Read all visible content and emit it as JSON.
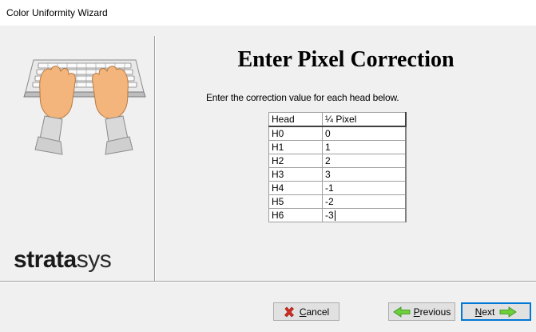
{
  "window": {
    "title": "Color Uniformity Wizard"
  },
  "brand": {
    "logo_bold": "strata",
    "logo_light": "sys"
  },
  "page": {
    "title": "Enter Pixel Correction",
    "instruction": "Enter the correction value for each head below."
  },
  "grid": {
    "columns": [
      "Head",
      "¼ Pixel"
    ],
    "rows": [
      {
        "head": "H0",
        "value": "0"
      },
      {
        "head": "H1",
        "value": "1"
      },
      {
        "head": "H2",
        "value": "2"
      },
      {
        "head": "H3",
        "value": "3"
      },
      {
        "head": "H4",
        "value": "-1"
      },
      {
        "head": "H5",
        "value": "-2"
      },
      {
        "head": "H6",
        "value": "-3"
      }
    ]
  },
  "buttons": {
    "cancel": {
      "mnemonic": "C",
      "rest": "ancel",
      "icon": "red-x-icon"
    },
    "previous": {
      "mnemonic": "P",
      "rest": "revious",
      "icon": "arrow-left-icon"
    },
    "next": {
      "mnemonic": "N",
      "rest": "ext",
      "icon": "arrow-right-icon"
    }
  },
  "colors": {
    "accent": "#0078d7",
    "cancel_icon": "#d62b1f",
    "arrow_icon_light": "#6fcf3a",
    "arrow_icon_dark": "#2e8f1a"
  }
}
